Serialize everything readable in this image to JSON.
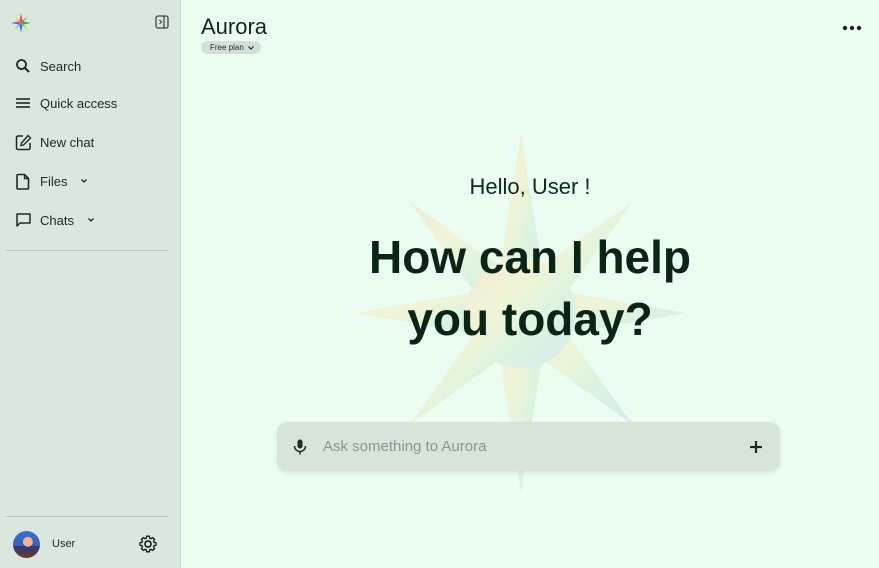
{
  "sidebar": {
    "items": [
      {
        "label": "Search",
        "icon": "search-icon"
      },
      {
        "label": "Quick access",
        "icon": "menu-icon"
      },
      {
        "label": "New chat",
        "icon": "edit-icon"
      },
      {
        "label": "Files",
        "icon": "file-icon"
      },
      {
        "label": "Chats",
        "icon": "chat-icon"
      }
    ],
    "user": {
      "name": "User"
    }
  },
  "header": {
    "title": "Aurora",
    "plan": "Free plan"
  },
  "main": {
    "greeting": "Hello, User !",
    "headline_line1": "How can I help",
    "headline_line2": "you today?"
  },
  "composer": {
    "placeholder": "Ask something to Aurora"
  },
  "colors": {
    "background": "#eafdf0",
    "sidebar": "#d9e7de",
    "composer": "#d7e4da",
    "text": "#0c2416"
  }
}
